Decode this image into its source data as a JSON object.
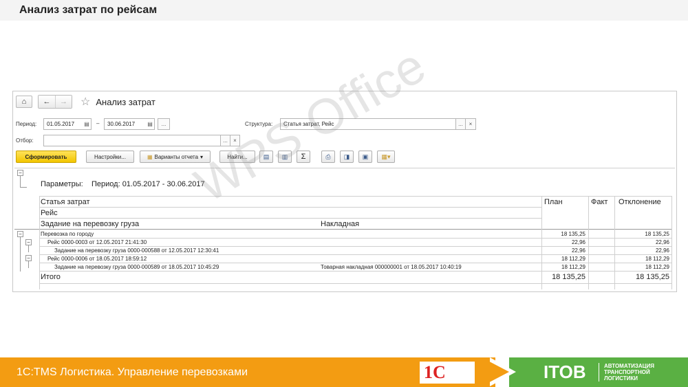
{
  "slide": {
    "title": "Анализ затрат по рейсам",
    "watermark": "WPS Office"
  },
  "window": {
    "title": "Анализ затрат",
    "period_label": "Период:",
    "period_from": "01.05.2017",
    "period_dash": "–",
    "period_to": "30.06.2017",
    "period_more": "...",
    "structure_label": "Структура:",
    "structure_value": "Статья затрат, Рейс",
    "structure_more": "...",
    "structure_clear": "×",
    "filter_label": "Отбор:",
    "filter_value": "",
    "filter_more": "...",
    "filter_clear": "×"
  },
  "toolbar": {
    "generate": "Сформировать",
    "settings": "Настройки...",
    "variants": "Варианты отчета",
    "find": "Найти...",
    "sigma": "Σ"
  },
  "report": {
    "params_label": "Параметры:",
    "params_value": "Период: 01.05.2017 - 30.06.2017",
    "headers": {
      "col1_l1": "Статья затрат",
      "col1_l2": "Рейс",
      "col1_l3": "Задание на перевозку груза",
      "col2_l3": "Накладная",
      "plan": "План",
      "fact": "Факт",
      "deviation": "Отклонение"
    },
    "rows": [
      {
        "name": "Перевозка по городу",
        "doc": "",
        "plan": "18 135,25",
        "fact": "",
        "dev": "18 135,25"
      },
      {
        "name": "Рейс 0000-0003 от 12.05.2017 21:41:30",
        "doc": "",
        "plan": "22,96",
        "fact": "",
        "dev": "22,96"
      },
      {
        "name": "Задание на перевозку груза 0000-000588 от 12.05.2017 12:30:41",
        "doc": "",
        "plan": "22,96",
        "fact": "",
        "dev": "22,96"
      },
      {
        "name": "Рейс 0000-0006 от 18.05.2017 18:59:12",
        "doc": "",
        "plan": "18 112,29",
        "fact": "",
        "dev": "18 112,29"
      },
      {
        "name": "Задание на перевозку груза 0000-000589 от 18.05.2017 10:45:29",
        "doc": "Товарная накладная 000000001 от 18.05.2017 10:40:19",
        "plan": "18 112,29",
        "fact": "",
        "dev": "18 112,29"
      }
    ],
    "total": {
      "name": "Итого",
      "plan": "18 135,25",
      "fact": "",
      "dev": "18 135,25"
    }
  },
  "footer": {
    "text": "1С:TMS Логистика. Управление перевозками",
    "logo_1c": "1С",
    "itob": "ITOB",
    "itob_sub1": "АВТОМАТИЗАЦИЯ",
    "itob_sub2": "ТРАНСПОРТНОЙ",
    "itob_sub3": "ЛОГИСТИКИ"
  }
}
